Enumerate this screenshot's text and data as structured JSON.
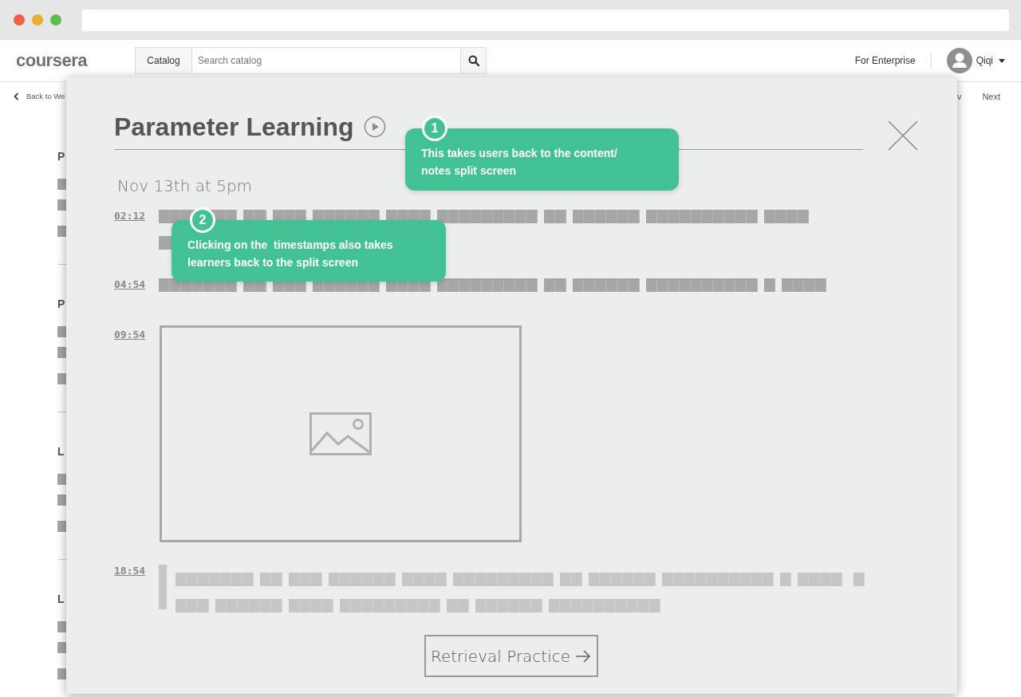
{
  "browser": {
    "traffic_lights": [
      {
        "color": "#ec6149"
      },
      {
        "color": "#e8ae2f"
      },
      {
        "color": "#5ebd49"
      }
    ]
  },
  "header": {
    "logo": "coursera",
    "catalog_button": "Catalog",
    "search": {
      "placeholder": "Search catalog"
    },
    "enterprise_link": "For Enterprise",
    "user_name": "Qiqi"
  },
  "subnav": {
    "back_link": "Back to We",
    "prev_link": "v",
    "next_link": "Next"
  },
  "background_sections": [
    {
      "heading": "P"
    },
    {
      "heading": "P"
    },
    {
      "heading": "L"
    },
    {
      "heading": "L"
    }
  ],
  "modal": {
    "title": "Parameter Learning",
    "date": "Nov 13th at 5pm",
    "entries": [
      {
        "time": "02:12",
        "kind": "paragraph"
      },
      {
        "time": "04:54",
        "kind": "line"
      },
      {
        "time": "09:54",
        "kind": "image"
      },
      {
        "time": "18:54",
        "kind": "quote"
      }
    ],
    "button": "Retrieval Practice"
  },
  "callouts": [
    {
      "number": "1",
      "text": "This takes users back to the content/ notes split screen"
    },
    {
      "number": "2",
      "text": "Clicking on the  timestamps also takes learners back to the split screen"
    }
  ]
}
